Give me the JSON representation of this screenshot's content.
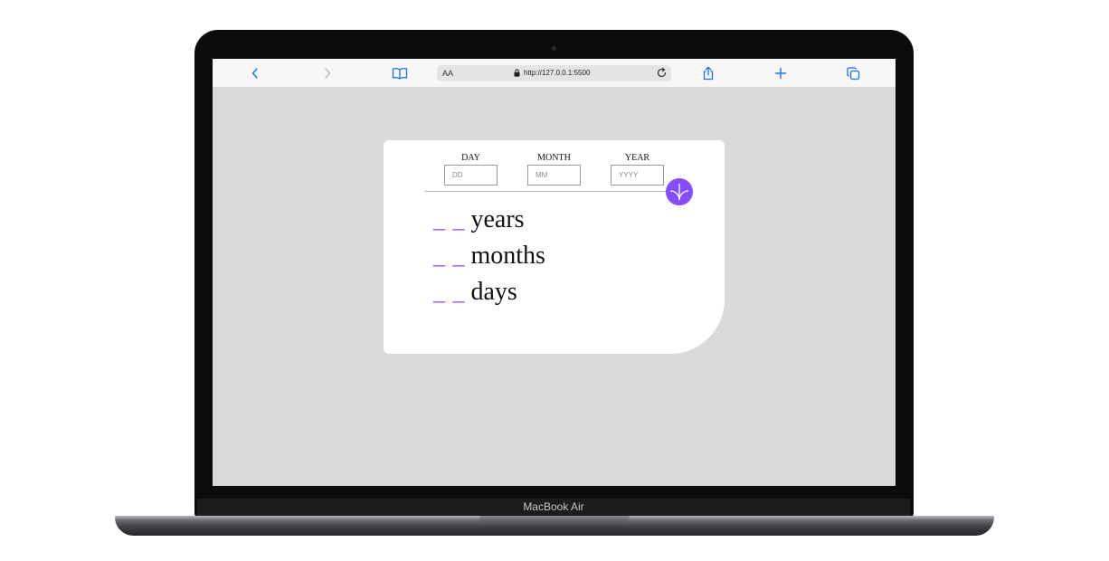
{
  "device": {
    "brand_label": "MacBook Air"
  },
  "browser": {
    "url_text_size": "AA",
    "url": "http://127.0.0.1:5500",
    "icons": {
      "back": "chevron-left-icon",
      "forward": "chevron-right-icon",
      "bookmarks": "book-icon",
      "lock": "lock-icon",
      "reload": "reload-icon",
      "share": "share-icon",
      "new_tab": "plus-icon",
      "tabs": "tabs-icon"
    }
  },
  "form": {
    "day": {
      "label": "DAY",
      "placeholder": "DD",
      "value": ""
    },
    "month": {
      "label": "MONTH",
      "placeholder": "MM",
      "value": ""
    },
    "year": {
      "label": "YEAR",
      "placeholder": "YYYY",
      "value": ""
    },
    "submit_icon": "arrow-down-icon"
  },
  "results": {
    "years": {
      "value": "_ _",
      "unit": "years"
    },
    "months": {
      "value": "_ _",
      "unit": "months"
    },
    "days": {
      "value": "_ _",
      "unit": "days"
    }
  },
  "colors": {
    "accent": "#854dff",
    "screen_bg": "#dadada",
    "card_bg": "#ffffff"
  }
}
